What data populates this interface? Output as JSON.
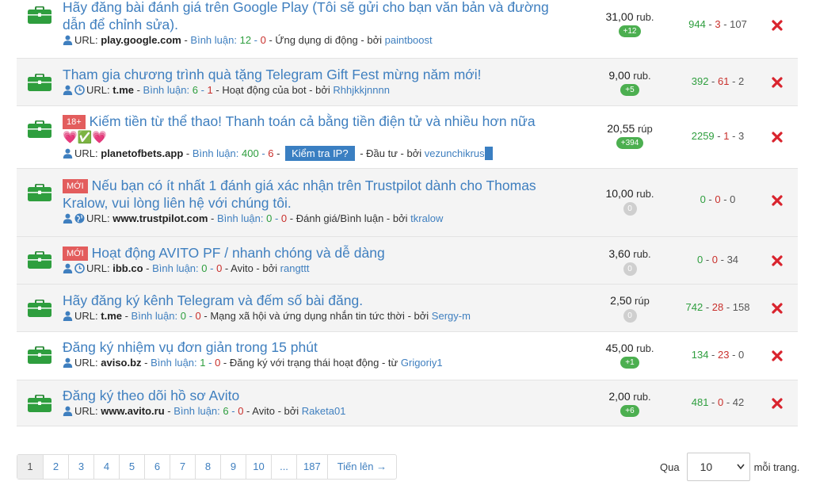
{
  "colors": {
    "link": "#3f7fbf",
    "accent_green": "#2e9e3e",
    "accent_red": "#c9302c",
    "badge_red": "#e35d5d",
    "pill_green": "#4caf50",
    "row_alt": "#f4f4f4"
  },
  "tasks": [
    {
      "title": "Hãy đăng bài đánh giá trên Google Play (Tôi sẽ gửi cho bạn văn bản và đường dẫn để chỉnh sửa).",
      "url_label": "URL:",
      "domain": "play.google.com",
      "comments_label": "Bình luận:",
      "comments": "12",
      "comments_new": "0",
      "category": "Ứng dụng di động",
      "by_label": "bởi",
      "author": "paintboost",
      "price": "31,00",
      "unit": "rub.",
      "pill": "+12",
      "stat_green": "944",
      "stat_red": "3",
      "stat_gray": "107",
      "icons": [
        "user-icon"
      ]
    },
    {
      "title": "Tham gia chương trình quà tặng Telegram Gift Fest mừng năm mới!",
      "url_label": "URL:",
      "domain": "t.me",
      "comments_label": "Bình luận:",
      "comments": "6",
      "comments_new": "1",
      "category": "Hoạt động của bot",
      "by_label": "bởi",
      "author": "Rhhjkkjnnnn",
      "price": "9,00",
      "unit": "rub.",
      "pill": "+5",
      "stat_green": "392",
      "stat_red": "61",
      "stat_gray": "2",
      "icons": [
        "user-icon",
        "clock-icon"
      ]
    },
    {
      "badge": "18+",
      "title": "Kiếm tiền từ thể thao! Thanh toán cả bằng tiền điện tử và nhiều hơn nữa",
      "emojis": "💗✅💗",
      "url_label": "URL:",
      "domain": "planetofbets.app",
      "comments_label": "Bình luận:",
      "comments": "400",
      "comments_new": "6",
      "ip_button": "Kiểm tra IP?",
      "category": "Đầu tư",
      "by_label": "bởi",
      "author": "vezunchikrus",
      "price": "20,55",
      "unit": "rúp",
      "pill": "+394",
      "stat_green": "2259",
      "stat_red": "1",
      "stat_gray": "3",
      "icons": [
        "user-icon"
      ]
    },
    {
      "badge": "MỚI",
      "title": "Nếu bạn có ít nhất 1 đánh giá xác nhận trên Trustpilot dành cho Thomas Kralow, vui lòng liên hệ với chúng tôi.",
      "url_label": "URL:",
      "domain": "www.trustpilot.com",
      "comments_label": "Bình luận:",
      "comments": "0",
      "comments_new": "0",
      "category": "Đánh giá/Bình luận",
      "by_label": "bởi",
      "author": "tkralow",
      "price": "10,00",
      "unit": "rub.",
      "pill": "0",
      "stat_green": "0",
      "stat_red": "0",
      "stat_gray": "0",
      "icons": [
        "user-icon",
        "globe-icon"
      ]
    },
    {
      "badge": "MỚI",
      "title": "Hoạt động AVITO PF / nhanh chóng và dễ dàng",
      "url_label": "URL:",
      "domain": "ibb.co",
      "comments_label": "Bình luận:",
      "comments": "0",
      "comments_new": "0",
      "category": "Avito",
      "by_label": "bởi",
      "author": "rangttt",
      "price": "3,60",
      "unit": "rub.",
      "pill": "0",
      "stat_green": "0",
      "stat_red": "0",
      "stat_gray": "34",
      "icons": [
        "user-icon",
        "clock-icon"
      ]
    },
    {
      "title": "Hãy đăng ký kênh Telegram và đếm số bài đăng.",
      "url_label": "URL:",
      "domain": "t.me",
      "comments_label": "Bình luận:",
      "comments": "0",
      "comments_new": "0",
      "category": "Mạng xã hội và ứng dụng nhắn tin tức thời",
      "by_label": "bởi",
      "author": "Sergy-m",
      "price": "2,50",
      "unit": "rúp",
      "pill": "0",
      "stat_green": "742",
      "stat_red": "28",
      "stat_gray": "158",
      "icons": [
        "user-icon"
      ]
    },
    {
      "title": "Đăng ký nhiệm vụ đơn giản trong 15 phút",
      "url_label": "URL:",
      "domain": "aviso.bz",
      "comments_label": "Bình luận:",
      "comments": "1",
      "comments_new": "0",
      "category": "Đăng ký với trạng thái hoạt động",
      "by_label": "từ",
      "author": "Grigoriy1",
      "price": "45,00",
      "unit": "rub.",
      "pill": "+1",
      "stat_green": "134",
      "stat_red": "23",
      "stat_gray": "0",
      "icons": [
        "user-icon"
      ]
    },
    {
      "title": "Đăng ký theo dõi hồ sơ Avito",
      "url_label": "URL:",
      "domain": "www.avito.ru",
      "comments_label": "Bình luận:",
      "comments": "6",
      "comments_new": "0",
      "category": "Avito",
      "by_label": "bởi",
      "author": "Raketa01",
      "price": "2,00",
      "unit": "rub.",
      "pill": "+6",
      "stat_green": "481",
      "stat_red": "0",
      "stat_gray": "42",
      "icons": [
        "user-icon"
      ]
    }
  ],
  "pagination": {
    "pages": [
      "1",
      "2",
      "3",
      "4",
      "5",
      "6",
      "7",
      "8",
      "9",
      "10",
      "...",
      "187"
    ],
    "active": "1",
    "next_label": "Tiến lên →"
  },
  "per_page": {
    "prefix": "Qua",
    "value": "10",
    "suffix": "mỗi trang."
  }
}
